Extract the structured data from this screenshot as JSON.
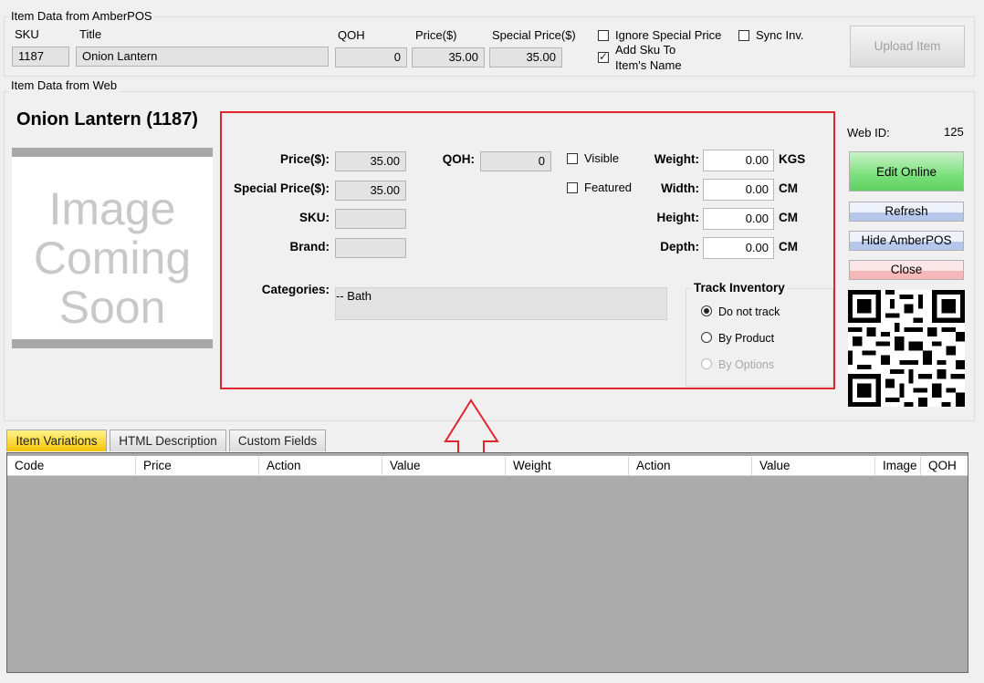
{
  "amberpos": {
    "group_title": "Item Data from AmberPOS",
    "sku_label": "SKU",
    "title_label": "Title",
    "qoh_label": "QOH",
    "price_label": "Price($)",
    "special_label": "Special Price($)",
    "sku": "1187",
    "title": "Onion Lantern",
    "qoh": "0",
    "price": "35.00",
    "special_price": "35.00",
    "ignore_special": "Ignore Special Price",
    "ignore_special_checked": false,
    "add_sku_line1": "Add Sku To",
    "add_sku_line2": "Item's Name",
    "add_sku_checked": true,
    "sync_inv": "Sync Inv.",
    "sync_inv_checked": false,
    "upload_button": "Upload Item"
  },
  "web": {
    "group_title": "Item Data from Web",
    "item_heading": "Onion Lantern (1187)",
    "image_text": [
      "Image",
      "Coming",
      "Soon"
    ],
    "price_label": "Price($):",
    "price": "35.00",
    "special_label": "Special Price($):",
    "special_price": "35.00",
    "sku_label": "SKU:",
    "sku": "",
    "brand_label": "Brand:",
    "brand": "",
    "qoh_label": "QOH:",
    "qoh": "0",
    "visible_label": "Visible",
    "visible_checked": false,
    "featured_label": "Featured",
    "featured_checked": false,
    "weight_label": "Weight:",
    "weight": "0.00",
    "weight_unit": "KGS",
    "width_label": "Width:",
    "width": "0.00",
    "width_unit": "CM",
    "height_label": "Height:",
    "height": "0.00",
    "height_unit": "CM",
    "depth_label": "Depth:",
    "depth": "0.00",
    "depth_unit": "CM",
    "categories_label": "Categories:",
    "categories_value": "-- Bath",
    "track_title": "Track Inventory",
    "track_options": [
      {
        "label": "Do not track",
        "selected": true,
        "enabled": true
      },
      {
        "label": "By Product",
        "selected": false,
        "enabled": true
      },
      {
        "label": "By Options",
        "selected": false,
        "enabled": false
      }
    ]
  },
  "side": {
    "web_id_label": "Web ID:",
    "web_id": "125",
    "edit_online": "Edit Online",
    "refresh": "Refresh",
    "hide_amberpos": "Hide AmberPOS",
    "close": "Close"
  },
  "tabs": [
    "Item Variations",
    "HTML Description",
    "Custom Fields"
  ],
  "active_tab": "Item Variations",
  "grid_columns": [
    "Code",
    "Price",
    "Action",
    "Value",
    "Weight",
    "Action",
    "Value",
    "Image",
    "QOH"
  ],
  "colors": {
    "highlight_box": "#e0262c",
    "edit_online": "#7be07b",
    "refresh": "#b5c7ea",
    "close": "#f6b8b8",
    "tab_active": "#f5c400",
    "grid_bg": "#ababab"
  }
}
